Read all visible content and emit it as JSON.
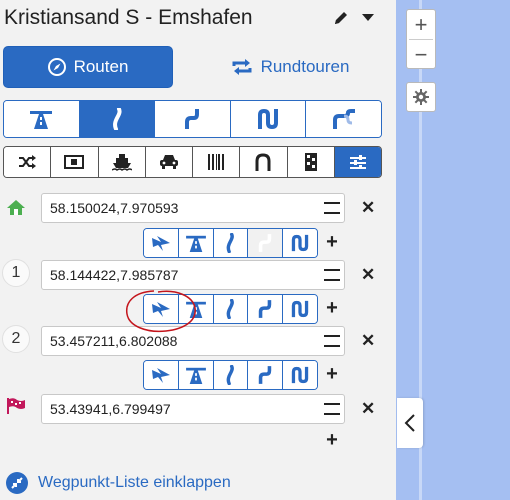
{
  "header": {
    "title": "Kristiansand S - Emshafen"
  },
  "tabs": {
    "routes_label": "Routen",
    "round_trips_label": "Rundtouren"
  },
  "colors": {
    "accent": "#2a6ac2",
    "map_water": "#a5bff2",
    "annotation": "#c4151c"
  },
  "profiles": {
    "items": [
      "motorway-icon",
      "curvy-road-icon",
      "twisty-road-icon",
      "very-twisty-road-icon",
      "extreme-twisty-road-icon"
    ],
    "active_index": 1
  },
  "options": {
    "items": [
      "shuffle-icon",
      "toll-icon",
      "ferry-icon",
      "car-icon",
      "unpaved-road-icon",
      "tunnel-icon",
      "border-crossing-icon",
      "settings-sliders-icon"
    ],
    "active_index": 7
  },
  "waypoints": [
    {
      "marker": "home-icon",
      "label": "",
      "value": "58.150024,7.970593"
    },
    {
      "marker": "number",
      "label": "1",
      "value": "58.144422,7.985787"
    },
    {
      "marker": "number",
      "label": "2",
      "value": "53.457211,6.802088"
    },
    {
      "marker": "flag-icon",
      "label": "",
      "value": "53.43941,6.799497"
    }
  ],
  "segments": [
    {
      "items": [
        "fastest-icon",
        "motorway-icon",
        "curvy-road-icon",
        "twisty-road-icon",
        "very-twisty-road-icon"
      ],
      "disabled_index": 3
    },
    {
      "items": [
        "fastest-icon",
        "motorway-icon",
        "curvy-road-icon",
        "twisty-road-icon",
        "very-twisty-road-icon"
      ],
      "disabled_index": -1
    },
    {
      "items": [
        "fastest-icon",
        "motorway-icon",
        "curvy-road-icon",
        "twisty-road-icon",
        "very-twisty-road-icon"
      ],
      "disabled_index": -1
    }
  ],
  "footer": {
    "collapse_label": "Wegpunkt-Liste einklappen"
  },
  "map": {
    "zoom_in": "+",
    "zoom_out": "−"
  }
}
